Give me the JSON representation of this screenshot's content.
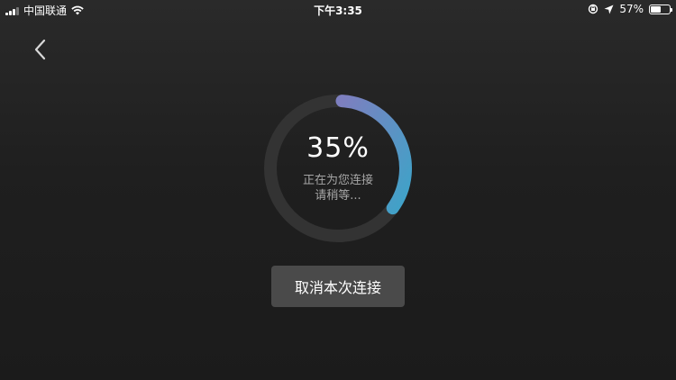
{
  "status_bar": {
    "carrier": "中国联通",
    "time": "下午3:35",
    "battery_percent": "57%",
    "battery_level": 0.57,
    "icons": [
      "signal-icon",
      "wifi-icon",
      "screen-lock-rotation-icon",
      "location-arrow-icon",
      "battery-icon"
    ]
  },
  "nav": {
    "back_icon": "chevron-left-icon"
  },
  "progress": {
    "value": 0.35,
    "percent_label": "35%",
    "message_line1": "正在为您连接",
    "message_line2": "请稍等...",
    "colors": {
      "track": "#333333",
      "start": "#7d7fbf",
      "end": "#3ea3c8"
    }
  },
  "actions": {
    "cancel_label": "取消本次连接"
  }
}
